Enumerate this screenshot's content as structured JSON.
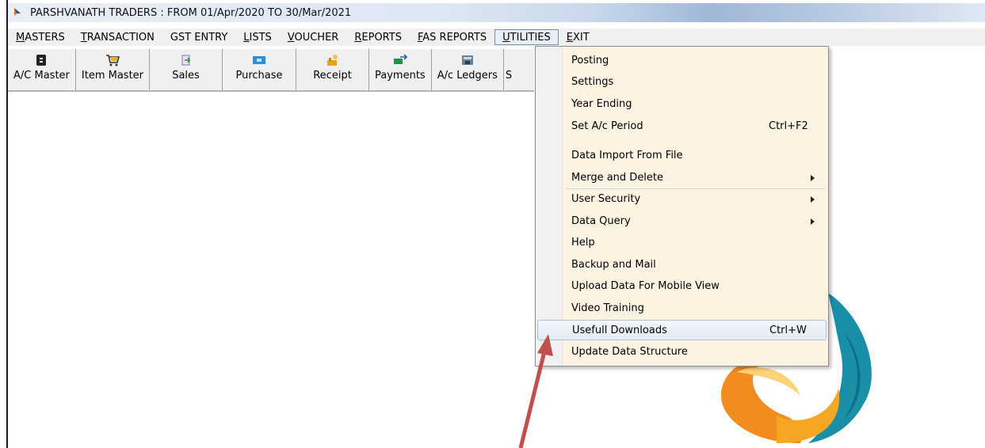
{
  "window": {
    "title": "PARSHVANATH TRADERS : FROM 01/Apr/2020 TO 30/Mar/2021"
  },
  "menubar": [
    {
      "underline": "M",
      "rest": "ASTERS"
    },
    {
      "underline": "T",
      "rest": "RANSACTION"
    },
    {
      "underline": "",
      "rest": "GST ENTRY"
    },
    {
      "underline": "L",
      "rest": "ISTS"
    },
    {
      "underline": "V",
      "rest": "OUCHER"
    },
    {
      "underline": "R",
      "rest": "EPORTS"
    },
    {
      "underline": "F",
      "rest": "AS REPORTS"
    },
    {
      "underline": "U",
      "rest": "TILITIES"
    },
    {
      "underline": "E",
      "rest": "XIT"
    }
  ],
  "toolbar": {
    "ac_master": "A/C Master",
    "item_master": "Item Master",
    "sales": "Sales",
    "purchase": "Purchase",
    "receipt": "Receipt",
    "payments": "Payments",
    "ac_ledgers": "A/c Ledgers",
    "partial": "S"
  },
  "utilities_menu": {
    "posting": "Posting",
    "settings": "Settings",
    "year_ending": "Year Ending",
    "set_ac_period": "Set A/c Period",
    "set_ac_period_shortcut": "Ctrl+F2",
    "data_import": "Data Import From File",
    "merge_delete": "Merge and Delete",
    "user_security": "User Security",
    "data_query": "Data Query",
    "help": "Help",
    "backup_mail": "Backup and Mail",
    "upload_mobile": "Upload Data For Mobile View",
    "video_training": "Video Training",
    "usefull_downloads": "Usefull Downloads",
    "usefull_downloads_shortcut": "Ctrl+W",
    "update_structure": "Update Data Structure"
  },
  "colors": {
    "menu_bg": "#fdf3e2",
    "highlight": "#e3ebf5",
    "arrow": "#c0504d"
  }
}
